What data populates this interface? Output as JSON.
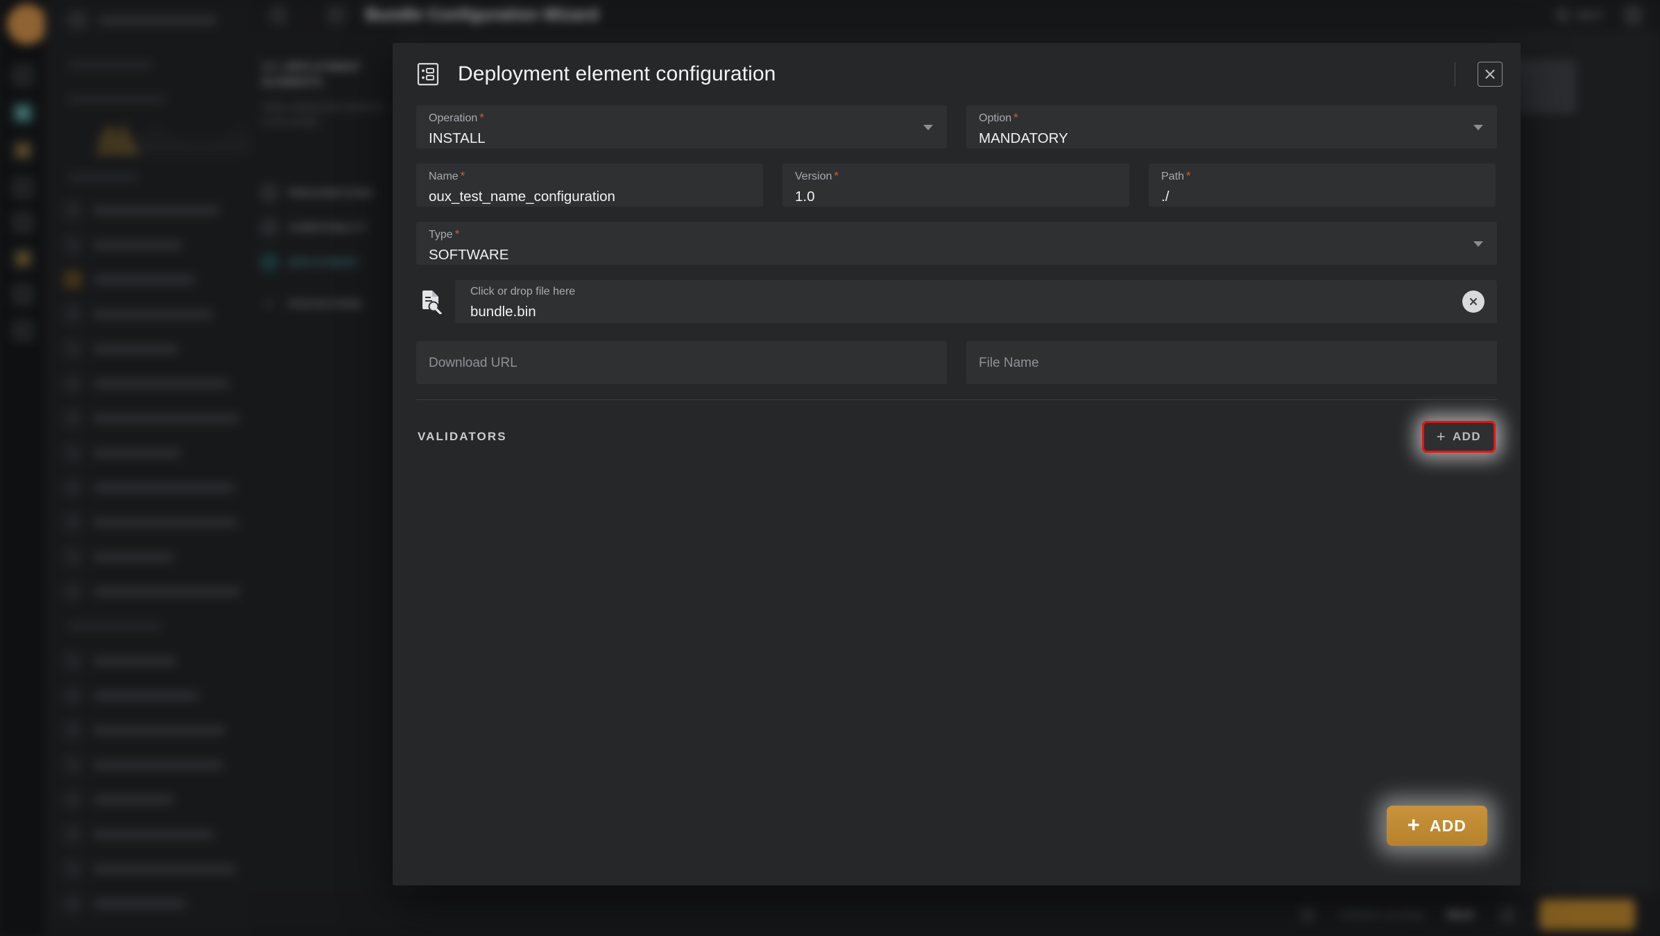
{
  "app": {
    "topbar": {
      "title": "Bundle Configuration Wizard",
      "help_label": "HELP",
      "menu_icon": "hamburger-icon",
      "grid_icon": "grid-icon",
      "user_icon": "user-avatar-icon"
    },
    "wizard": {
      "title": "3.1. DEPLOYMENT ELEMENTS",
      "subtitle": "Select deployment elements to the bundle",
      "steps": [
        {
          "label": "PRECONDITIONS",
          "state": "done"
        },
        {
          "label": "COMPATIBILITY",
          "state": "done"
        },
        {
          "label": "DEPLOYMENT",
          "state": "active"
        },
        {
          "label": "POSTACTIONS",
          "state": "pending"
        }
      ],
      "add_step_label": "+"
    },
    "footer": {
      "hint": "Validation pending",
      "next_label": "Next",
      "count": "2",
      "primary_label": "CONTINUE"
    }
  },
  "dialog": {
    "title": "Deployment element configuration",
    "title_icon": "form-list-icon",
    "close_icon": "close-icon",
    "fields": {
      "operation": {
        "label": "Operation",
        "required": true,
        "value": "INSTALL",
        "control": "select"
      },
      "option": {
        "label": "Option",
        "required": true,
        "value": "MANDATORY",
        "control": "select"
      },
      "name": {
        "label": "Name",
        "required": true,
        "value": "oux_test_name_configuration",
        "control": "text"
      },
      "version": {
        "label": "Version",
        "required": true,
        "value": "1.0",
        "control": "text"
      },
      "path": {
        "label": "Path",
        "required": true,
        "value": "./",
        "control": "text"
      },
      "type": {
        "label": "Type",
        "required": true,
        "value": "SOFTWARE",
        "control": "select"
      }
    },
    "file_upload": {
      "icon": "file-search-icon",
      "label": "Click or drop file here",
      "value": "bundle.bin",
      "clear_icon": "clear-file-icon"
    },
    "download_url": {
      "placeholder": "Download URL",
      "value": ""
    },
    "file_name": {
      "placeholder": "File Name",
      "value": ""
    },
    "validators": {
      "title": "VALIDATORS",
      "add_label": "ADD",
      "add_plus": "+",
      "highlighted": true
    },
    "primary_action": {
      "label": "ADD",
      "plus": "+",
      "color": "#b5822b"
    }
  },
  "colors": {
    "accent_orange": "#b5822b",
    "required_asterisk": "#cc5c3d",
    "highlight_red": "#ee1111",
    "dialog_bg": "#262729",
    "field_bg": "#2f3032",
    "active_step_teal": "#4f9ea3"
  }
}
